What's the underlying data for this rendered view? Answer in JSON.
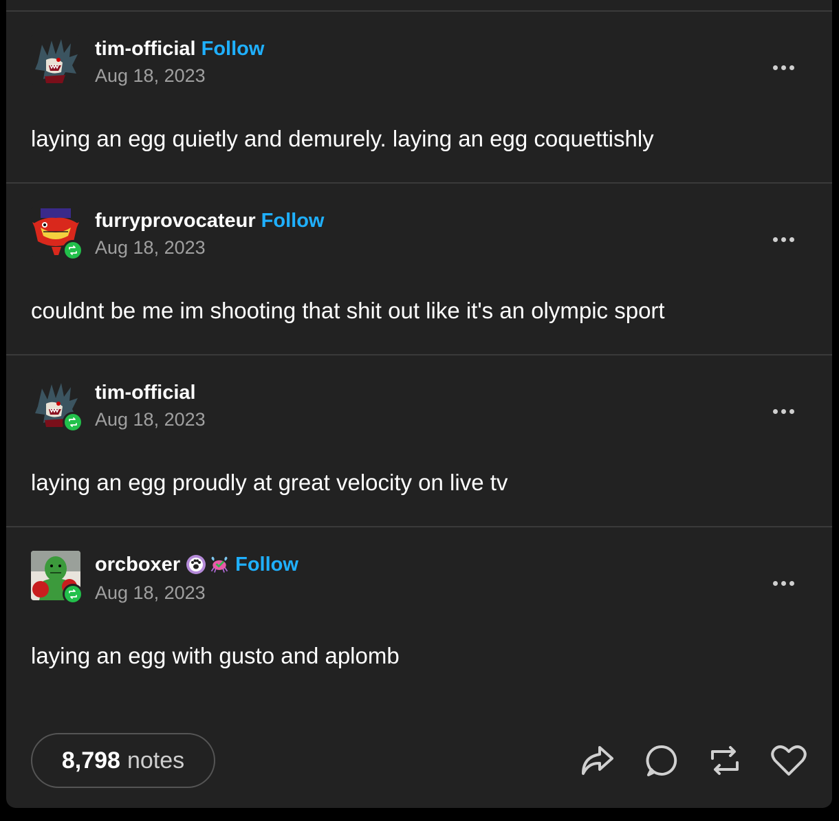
{
  "posts": [
    {
      "username": "tim-official",
      "follow_label": "Follow",
      "date": "Aug 18, 2023",
      "text": "laying an egg quietly and demurely. laying an egg coquettishly",
      "avatar_icon": "hedgehog-avatar-icon",
      "reblogged": false
    },
    {
      "username": "furryprovocateur",
      "follow_label": "Follow",
      "date": "Aug 18, 2023",
      "text": "couldnt be me im shooting that shit out like it's an olympic sport",
      "avatar_icon": "red-creature-avatar-icon",
      "reblogged": true
    },
    {
      "username": "tim-official",
      "date": "Aug 18, 2023",
      "text": "laying an egg proudly at great velocity on live tv",
      "avatar_icon": "hedgehog-avatar-icon",
      "reblogged": true
    },
    {
      "username": "orcboxer",
      "follow_label": "Follow",
      "date": "Aug 18, 2023",
      "text": "laying an egg with gusto and aplomb",
      "avatar_icon": "orc-boxer-avatar-icon",
      "reblogged": true,
      "badges": [
        "paw-badge-icon",
        "crab-badge-icon"
      ]
    }
  ],
  "footer": {
    "notes_count": "8,798",
    "notes_label": "notes",
    "actions": [
      "share-icon",
      "reply-icon",
      "reblog-icon",
      "like-icon"
    ]
  },
  "colors": {
    "background": "#222222",
    "follow": "#1fb0ff",
    "reblog_badge": "#22c04b",
    "date_text": "#a0a0a0"
  }
}
